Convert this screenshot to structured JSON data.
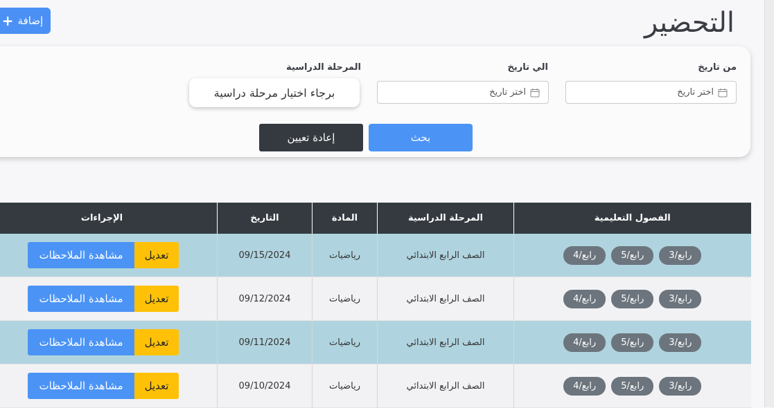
{
  "page": {
    "title": "التحضير",
    "add_button": "إضافة"
  },
  "filters": {
    "from_date": {
      "label": "من تاريخ",
      "placeholder": "اختر تاريخ"
    },
    "to_date": {
      "label": "الي تاريخ",
      "placeholder": "اختر تاريخ"
    },
    "stage": {
      "label": "المرحلة الدراسية",
      "placeholder": "برجاء اختيار مرحلة دراسية"
    },
    "search_button": "بحث",
    "reset_button": "إعادة تعيين"
  },
  "table": {
    "headers": [
      "الفصول التعليمية",
      "المرحلة الدراسية",
      "المادة",
      "التاريخ",
      "الإجراءات"
    ],
    "rows": [
      {
        "classes": [
          "رابع/3",
          "رابع/5",
          "رابع/4"
        ],
        "stage": "الصف الرابع الابتدائي",
        "subject": "رياضيات",
        "date": "09/15/2024",
        "edit": "تعديل",
        "notes": "مشاهدة الملاحظات"
      },
      {
        "classes": [
          "رابع/3",
          "رابع/5",
          "رابع/4"
        ],
        "stage": "الصف الرابع الابتدائي",
        "subject": "رياضيات",
        "date": "09/12/2024",
        "edit": "تعديل",
        "notes": "مشاهدة الملاحظات"
      },
      {
        "classes": [
          "رابع/3",
          "رابع/5",
          "رابع/4"
        ],
        "stage": "الصف الرابع الابتدائي",
        "subject": "رياضيات",
        "date": "09/11/2024",
        "edit": "تعديل",
        "notes": "مشاهدة الملاحظات"
      },
      {
        "classes": [
          "رابع/3",
          "رابع/5",
          "رابع/4"
        ],
        "stage": "الصف الرابع الابتدائي",
        "subject": "رياضيات",
        "date": "09/10/2024",
        "edit": "تعديل",
        "notes": "مشاهدة الملاحظات"
      }
    ]
  },
  "colors": {
    "primary": "#4b94f6",
    "dark": "#343a40",
    "warning": "#ffc107",
    "row_highlight": "#b0d4df",
    "chip": "#6c757d"
  },
  "icons": {
    "add": "plus-icon",
    "date": "calendar-icon"
  }
}
